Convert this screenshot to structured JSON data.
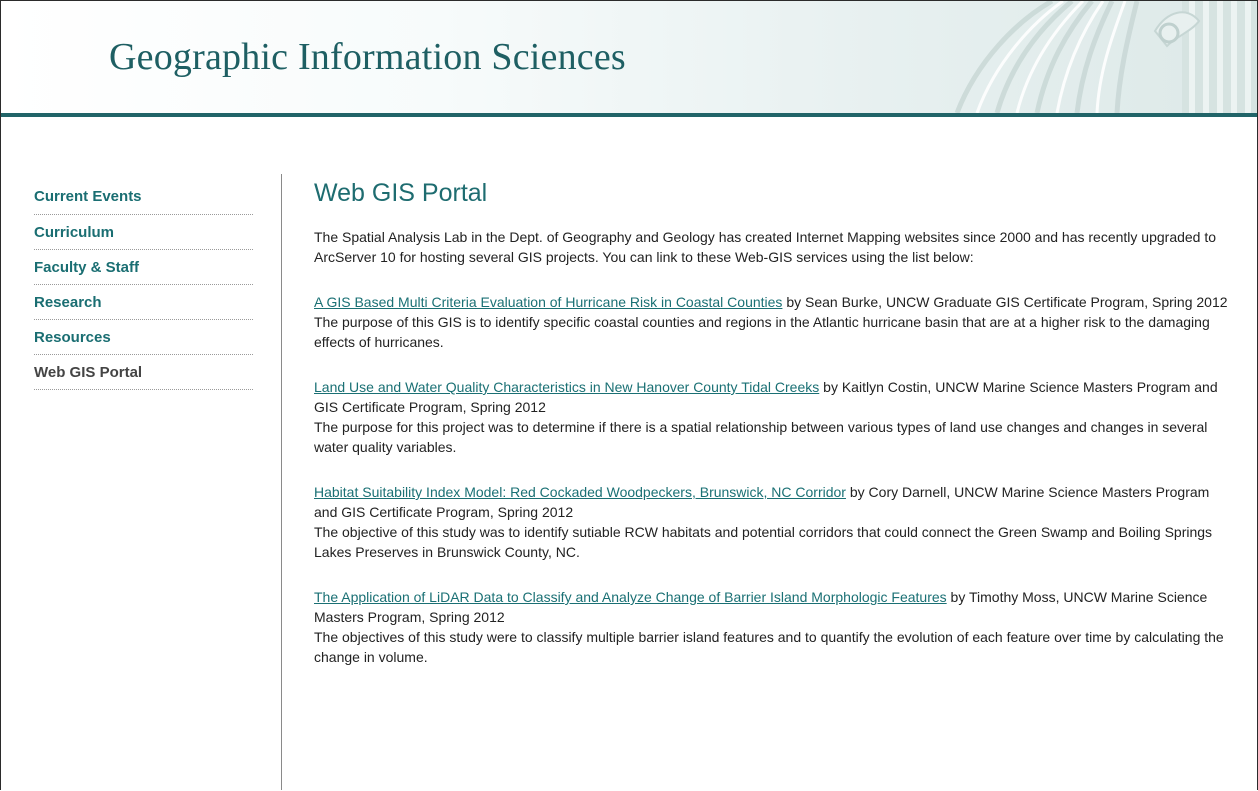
{
  "site": {
    "title": "Geographic Information Sciences"
  },
  "nav": {
    "items": [
      {
        "label": "Current Events"
      },
      {
        "label": "Curriculum"
      },
      {
        "label": "Faculty & Staff"
      },
      {
        "label": "Research"
      },
      {
        "label": "Resources"
      },
      {
        "label": "Web GIS Portal"
      }
    ],
    "current": "Web GIS Portal"
  },
  "main": {
    "title": "Web GIS Portal",
    "intro": "The Spatial Analysis Lab in the Dept. of Geography and Geology has created Internet Mapping websites since 2000 and has recently upgraded to ArcServer 10 for hosting several GIS projects. You can link to these Web-GIS services using the list below:",
    "projects": [
      {
        "link": "A GIS Based Multi Criteria Evaluation of Hurricane Risk in Coastal Counties",
        "byline": " by Sean Burke, UNCW Graduate GIS Certificate Program, Spring 2012",
        "description": "The purpose of this GIS is to identify specific coastal counties and regions in the Atlantic hurricane basin that are at a higher risk to the damaging effects of hurricanes."
      },
      {
        "link": "Land Use and Water Quality Characteristics in New Hanover County Tidal Creeks",
        "byline": " by Kaitlyn Costin, UNCW Marine Science Masters Program and GIS Certificate Program, Spring 2012",
        "description": "The purpose for this project was to determine if there is a spatial relationship between various types of land use changes and changes in several water quality variables."
      },
      {
        "link": "Habitat Suitability Index Model: Red Cockaded Woodpeckers, Brunswick, NC Corridor",
        "byline": " by Cory Darnell, UNCW Marine Science Masters Program and GIS Certificate Program, Spring 2012",
        "description": "The objective of this study was to identify sutiable RCW habitats and potential corridors that could connect the Green Swamp and Boiling Springs Lakes Preserves in Brunswick County, NC."
      },
      {
        "link": "The Application of LiDAR Data to Classify and Analyze Change of Barrier Island Morphologic Features",
        "byline": " by Timothy Moss, UNCW Marine Science Masters Program, Spring 2012",
        "description": "The objectives of this study were to classify multiple barrier island features and to quantify the evolution of each feature over time by calculating the change in volume."
      }
    ]
  },
  "colors": {
    "accent": "#216468",
    "link": "#1a7074",
    "title": "#1e5f63"
  }
}
